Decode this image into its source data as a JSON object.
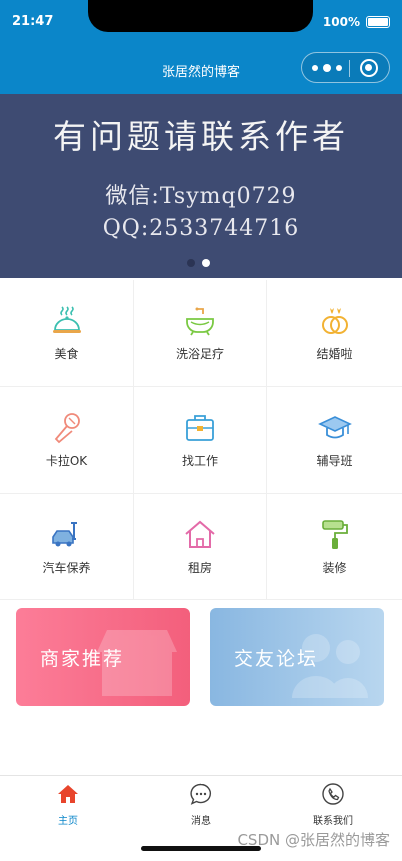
{
  "status_bar": {
    "time": "21:47",
    "battery": "100%"
  },
  "nav": {
    "title": "张居然的博客"
  },
  "banner": {
    "headline": "有问题请联系作者",
    "wechat": "微信:Tsymq0729",
    "qq": "QQ:2533744716",
    "slides": 2,
    "active_slide": 2
  },
  "categories": [
    {
      "label": "美食",
      "icon": "dish-cover-icon"
    },
    {
      "label": "洗浴足疗",
      "icon": "bathtub-icon"
    },
    {
      "label": "结婚啦",
      "icon": "wedding-rings-icon"
    },
    {
      "label": "卡拉OK",
      "icon": "microphone-icon"
    },
    {
      "label": "找工作",
      "icon": "briefcase-icon"
    },
    {
      "label": "辅导班",
      "icon": "graduation-cap-icon"
    },
    {
      "label": "汽车保养",
      "icon": "car-service-icon"
    },
    {
      "label": "租房",
      "icon": "house-icon"
    },
    {
      "label": "装修",
      "icon": "paint-roller-icon"
    }
  ],
  "promos": {
    "left": "商家推荐",
    "right": "交友论坛"
  },
  "tabs": [
    {
      "label": "主页",
      "icon": "home-icon",
      "active": true
    },
    {
      "label": "消息",
      "icon": "chat-bubble-icon",
      "active": false
    },
    {
      "label": "联系我们",
      "icon": "phone-icon",
      "active": false
    }
  ],
  "watermark": "CSDN @张居然的博客",
  "colors": {
    "primary": "#0b86c9",
    "banner": "#3e4b72",
    "promo_red": "#f35f7c",
    "promo_blue": "#89b7e1"
  }
}
